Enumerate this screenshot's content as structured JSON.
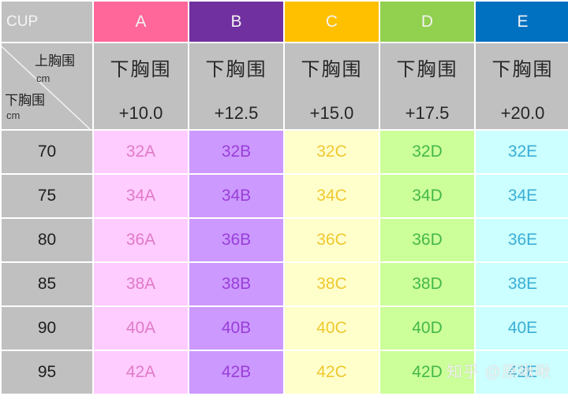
{
  "corner": {
    "cup_label": "CUP",
    "top_label": "上胸围",
    "top_unit": "cm",
    "bottom_label": "下胸围",
    "bottom_unit": "cm"
  },
  "cups": [
    {
      "letter": "A",
      "header_color": "#ff6699",
      "cell_bg": "#ffccff",
      "text_color": "#e07ac8",
      "sub_label": "下胸围",
      "offset": "+10.0"
    },
    {
      "letter": "B",
      "header_color": "#7030a0",
      "cell_bg": "#cc99ff",
      "text_color": "#9a3fd8",
      "sub_label": "下胸围",
      "offset": "+12.5"
    },
    {
      "letter": "C",
      "header_color": "#ffc000",
      "cell_bg": "#ffffcc",
      "text_color": "#f0c830",
      "sub_label": "下胸围",
      "offset": "+15.0"
    },
    {
      "letter": "D",
      "header_color": "#92d050",
      "cell_bg": "#ccff99",
      "text_color": "#44b84a",
      "sub_label": "下胸围",
      "offset": "+17.5"
    },
    {
      "letter": "E",
      "header_color": "#0070c0",
      "cell_bg": "#ccffff",
      "text_color": "#3aaed6",
      "sub_label": "下胸围",
      "offset": "+20.0"
    }
  ],
  "rows": [
    {
      "underbust": "70",
      "sizes": [
        "32A",
        "32B",
        "32C",
        "32D",
        "32E"
      ]
    },
    {
      "underbust": "75",
      "sizes": [
        "34A",
        "34B",
        "34C",
        "34D",
        "34E"
      ]
    },
    {
      "underbust": "80",
      "sizes": [
        "36A",
        "36B",
        "36C",
        "36D",
        "36E"
      ]
    },
    {
      "underbust": "85",
      "sizes": [
        "38A",
        "38B",
        "38C",
        "38D",
        "38E"
      ]
    },
    {
      "underbust": "90",
      "sizes": [
        "40A",
        "40B",
        "40C",
        "40D",
        "40E"
      ]
    },
    {
      "underbust": "95",
      "sizes": [
        "42A",
        "42B",
        "42C",
        "42D",
        "42E"
      ]
    }
  ],
  "watermark": "知乎 @原啾啾"
}
